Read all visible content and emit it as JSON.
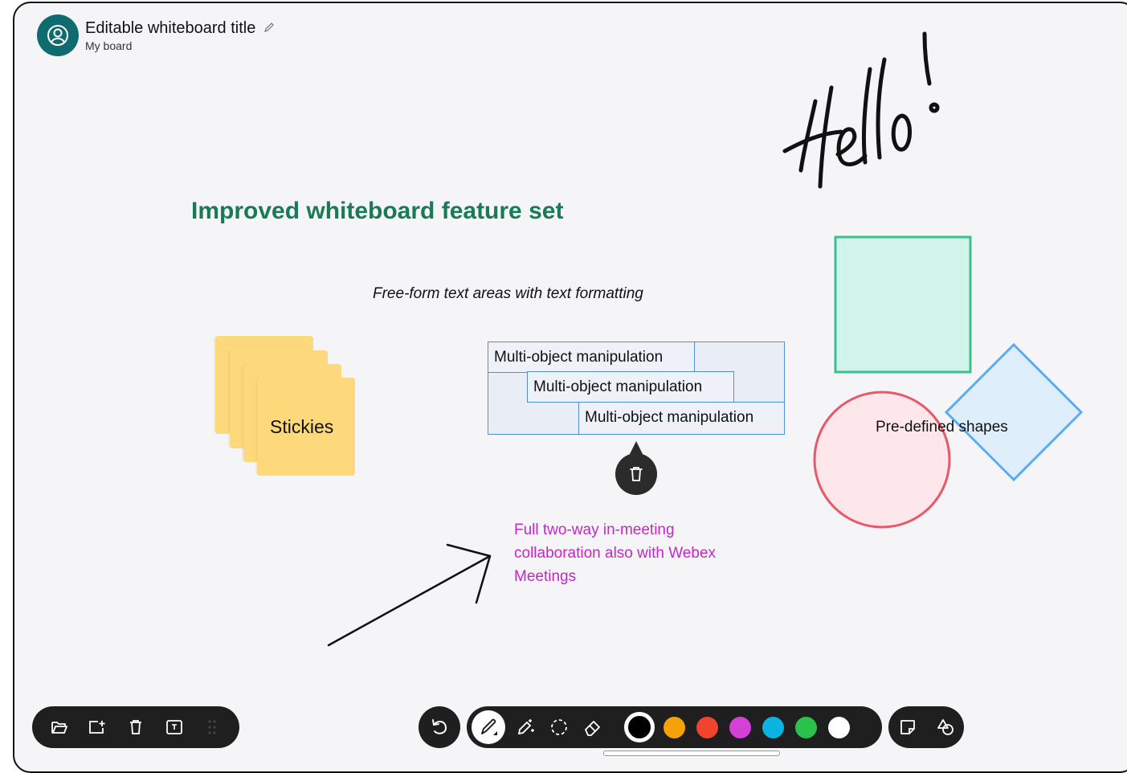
{
  "header": {
    "title": "Editable whiteboard title",
    "subtitle": "My board",
    "avatar_icon": "user-circle-icon",
    "edit_icon": "pencil-icon"
  },
  "canvas": {
    "handwriting": "Hello!",
    "heading": "Improved whiteboard feature set",
    "freeform_text": "Free-form text areas with text formatting",
    "sticky_label": "Stickies",
    "multi_object": [
      "Multi-object manipulation",
      "Multi-object manipulation",
      "Multi-object manipulation"
    ],
    "collaboration_text": "Full two-way in-meeting collaboration also with Webex Meetings",
    "shapes_label": "Pre-defined shapes",
    "colors": {
      "heading": "#1a7a55",
      "collaboration": "#c427c4",
      "sticky": "#fed97b",
      "square_fill": "#d0f4e9",
      "square_stroke": "#3dbf8e",
      "circle_fill": "#fde7ea",
      "circle_stroke": "#e8586b",
      "diamond_fill": "#d9ecfb",
      "diamond_stroke": "#5aaef0"
    }
  },
  "toolbar_left": {
    "items": [
      "open-folder-icon",
      "new-board-icon",
      "trash-icon",
      "text-box-icon",
      "drag-handle-icon"
    ]
  },
  "toolbar_main": {
    "undo": "undo-icon",
    "tools": [
      "pen-icon",
      "magic-pen-icon",
      "lasso-select-icon",
      "eraser-icon"
    ],
    "active_tool": "pen-icon",
    "colors": [
      "#000000",
      "#f5a20a",
      "#f0442c",
      "#d341d6",
      "#0ab3e0",
      "#2cc14a",
      "#ffffff"
    ],
    "selected_color": "#000000"
  },
  "toolbar_right": {
    "items": [
      "sticky-note-icon",
      "shapes-icon"
    ]
  }
}
